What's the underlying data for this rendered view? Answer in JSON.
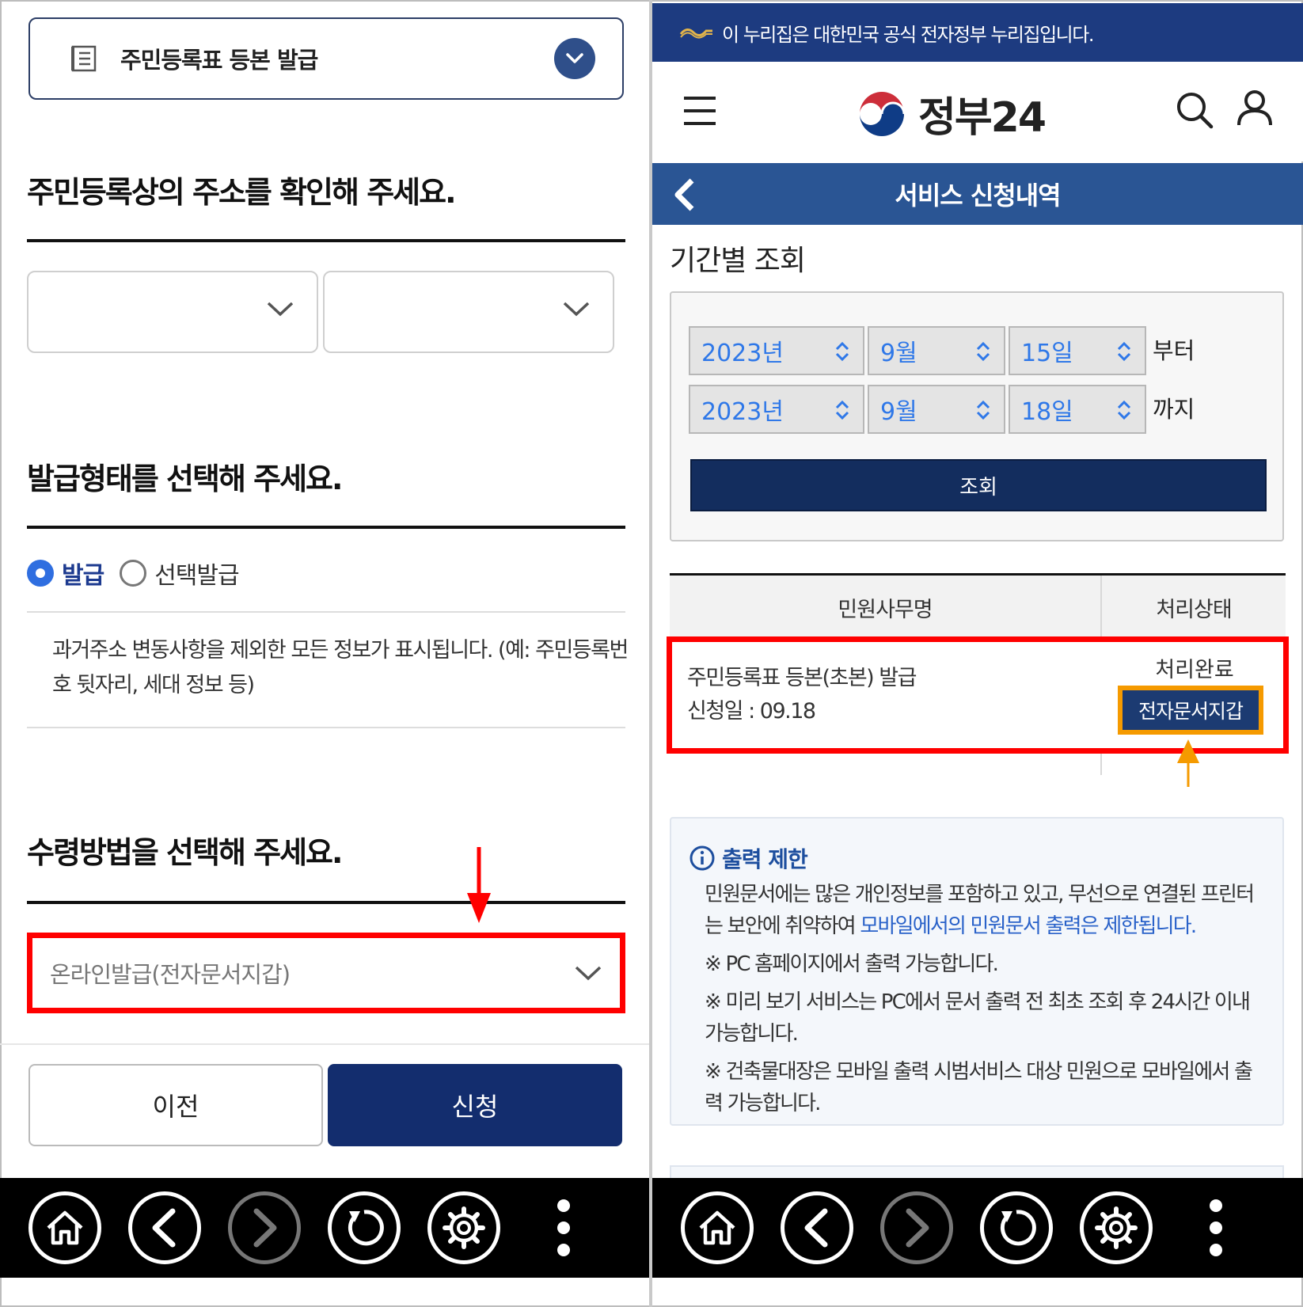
{
  "left": {
    "service_title": "주민등록표 등본 발급",
    "section_address": "주민등록상의 주소를 확인해 주세요.",
    "section_issue_type": "발급형태를 선택해 주세요.",
    "issue_type_options": [
      "발급",
      "선택발급"
    ],
    "issue_type_selected": "발급",
    "issue_type_description": "과거주소 변동사항을 제외한 모든 정보가 표시됩니다. (예: 주민등록번호 뒷자리, 세대 정보 등)",
    "section_receive": "수령방법을 선택해 주세요.",
    "receive_method": "온라인발급(전자문서지갑)",
    "btn_prev": "이전",
    "btn_apply": "신청"
  },
  "right": {
    "gov_banner": "이 누리집은 대한민국 공식 전자정부 누리집입니다.",
    "logo_text": "정부24",
    "page_title": "서비스 신청내역",
    "period_label": "기간별 조회",
    "from": {
      "year": "2023년",
      "month": "9월",
      "day": "15일",
      "suffix": "부터"
    },
    "to": {
      "year": "2023년",
      "month": "9월",
      "day": "18일",
      "suffix": "까지"
    },
    "query_button": "조회",
    "table": {
      "headers": [
        "민원사무명",
        "처리상태"
      ],
      "rows": [
        {
          "name": "주민등록표 등본(초본) 발급",
          "applied": "신청일 : 09.18",
          "status": "처리완료",
          "action": "전자문서지갑"
        }
      ]
    },
    "notice": {
      "title": "출력 제한",
      "para1_a": "민원문서에는 많은 개인정보를 포함하고 있고, 무선으로 연결된 프린터는 보안에 취약하여 ",
      "para1_b": "모바일에서의 민원문서 출력은 제한됩니다.",
      "para2": "※ PC 홈페이지에서 출력 가능합니다.",
      "para3": "※ 미리 보기 서비스는 PC에서 문서 출력 전 최초 조회 후 24시간 이내 가능합니다.",
      "para4": "※ 건축물대장은 모바일 출력 시범서비스 대상 민원으로 모바일에서 출력 가능합니다."
    }
  },
  "colors": {
    "navy": "#132d6e",
    "title_bar": "#2a5594",
    "highlight_red": "#ff0000",
    "highlight_orange": "#f59a00",
    "radio_blue": "#2f6ee0"
  },
  "icons": [
    "document-icon",
    "chevron-down-icon",
    "home-icon",
    "back-icon",
    "forward-icon",
    "refresh-icon",
    "settings-icon",
    "more-icon",
    "menu-icon",
    "search-icon",
    "user-icon",
    "info-icon"
  ]
}
